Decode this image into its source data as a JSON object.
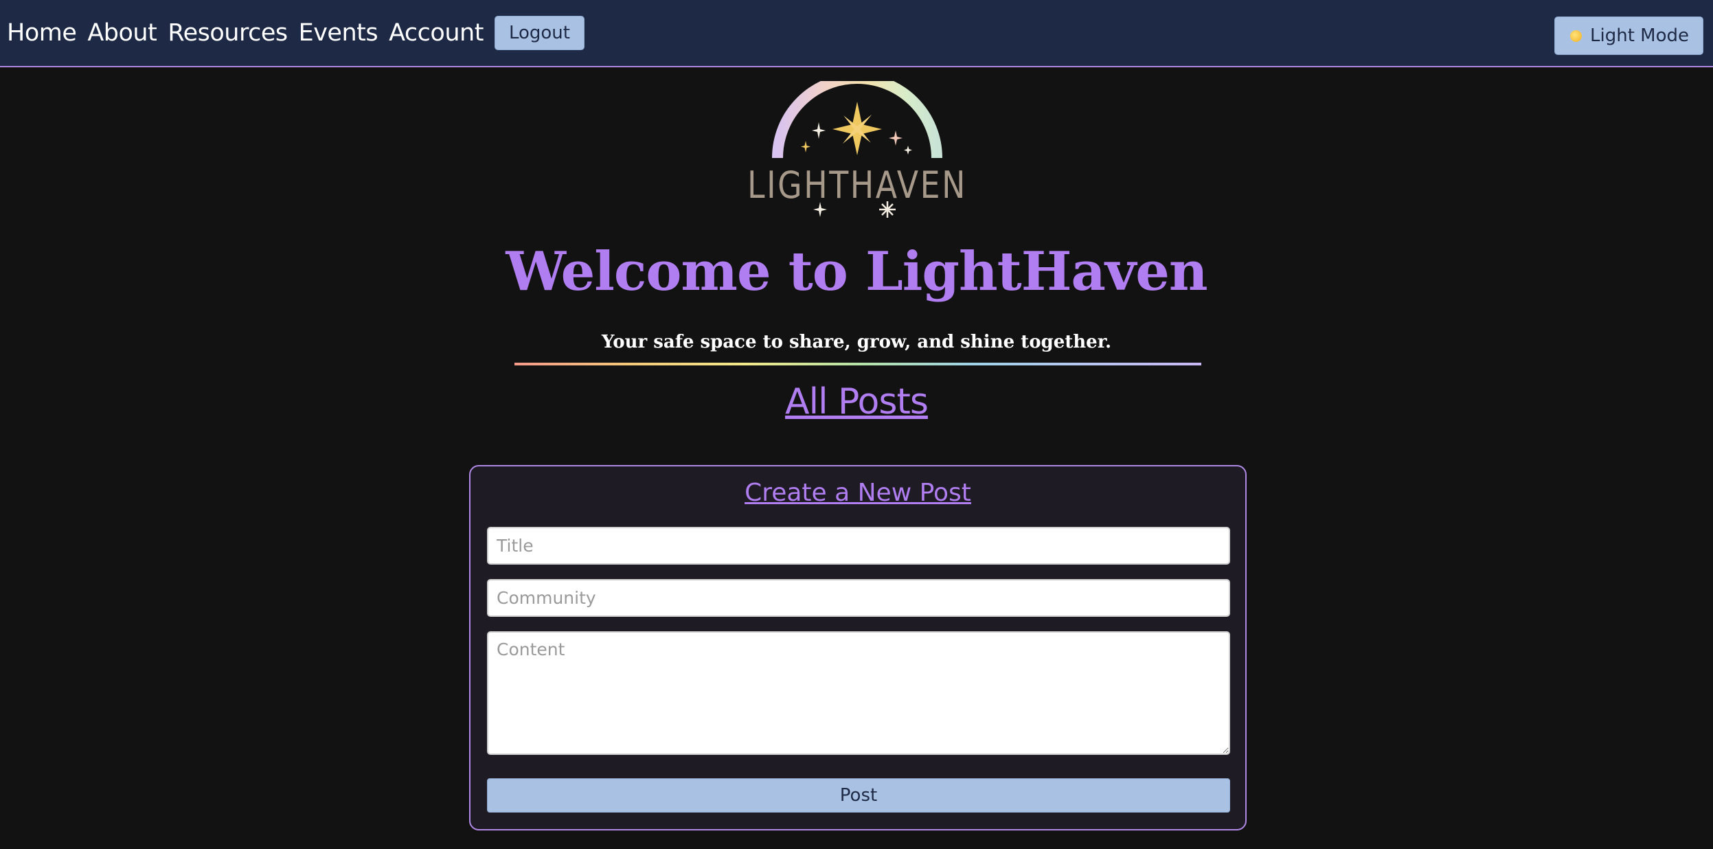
{
  "nav": {
    "links": [
      "Home",
      "About",
      "Resources",
      "Events",
      "Account"
    ],
    "logout_label": "Logout",
    "mode_toggle_label": "Light Mode",
    "mode_icon": "sun-icon"
  },
  "logo": {
    "text": "LIGHTHAVEN"
  },
  "hero": {
    "title": "Welcome to LightHaven",
    "tagline": "Your safe space to share, grow, and shine together."
  },
  "posts_section": {
    "title": "All Posts"
  },
  "new_post_form": {
    "title": "Create a New Post",
    "title_placeholder": "Title",
    "title_value": "",
    "community_placeholder": "Community",
    "community_value": "",
    "content_placeholder": "Content",
    "content_value": "",
    "submit_label": "Post"
  },
  "colors": {
    "nav_bg": "#1e2a45",
    "page_bg": "#121212",
    "accent_purple": "#b07ef0",
    "button_blue": "#a9c1e3",
    "card_bg": "#1e1b24",
    "logo_gold": "#f0c860",
    "logo_text": "#a89a8a"
  }
}
